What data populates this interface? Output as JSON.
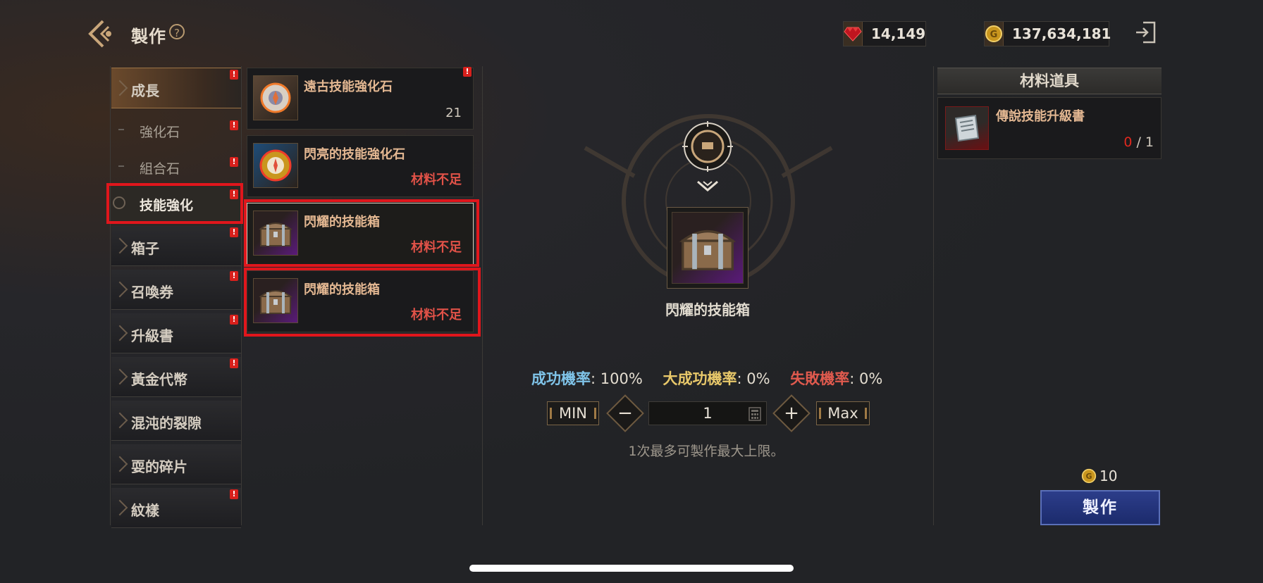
{
  "header": {
    "title": "製作",
    "help_glyph": "?",
    "gems_value": "14,149",
    "gold_value": "137,634,181"
  },
  "sidebar": {
    "items": [
      {
        "label": "成長"
      },
      {
        "label": "強化石"
      },
      {
        "label": "組合石"
      },
      {
        "label": "技能強化"
      },
      {
        "label": "箱子"
      },
      {
        "label": "召喚券"
      },
      {
        "label": "升級書"
      },
      {
        "label": "黃金代幣"
      },
      {
        "label": "混沌的裂隙"
      },
      {
        "label": "耍的碎片"
      },
      {
        "label": "紋樣"
      }
    ],
    "alert_glyph": "!"
  },
  "recipes": [
    {
      "name": "遠古技能強化石",
      "count": "21"
    },
    {
      "name": "閃亮的技能強化石",
      "status": "材料不足"
    },
    {
      "name": "閃耀的技能箱",
      "status": "材料不足"
    },
    {
      "name": "閃耀的技能箱",
      "status": "材料不足"
    }
  ],
  "craft": {
    "item_name": "閃耀的技能箱",
    "success_label": "成功機率",
    "success_value": ": 100%",
    "great_label": "大成功機率",
    "great_value": ": 0%",
    "fail_label": "失敗機率",
    "fail_value": ": 0%",
    "min_label": "MIN",
    "max_label": "Max",
    "minus_glyph": "−",
    "plus_glyph": "+",
    "quantity": "1",
    "hint": "1次最多可製作最大上限。",
    "cost": "10",
    "button_label": "製作"
  },
  "materials": {
    "header": "材料道具",
    "items": [
      {
        "name": "傳說技能升級書",
        "have": "0",
        "need": " / 1"
      }
    ]
  },
  "colors": {
    "accent_gold": "#e4b892",
    "warning_red": "#e25248",
    "highlight_box": "#e0161c",
    "craft_button": "#2c3d8a"
  }
}
